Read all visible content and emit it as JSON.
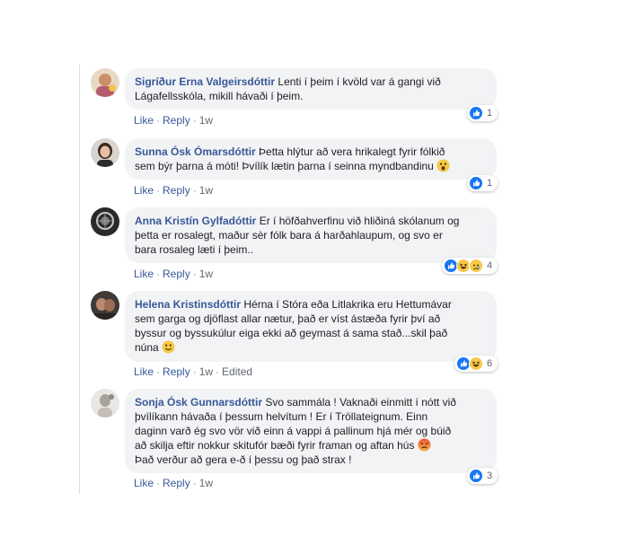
{
  "comments": [
    {
      "author": "Sigríður Erna Valgeirsdóttir",
      "text": "Lenti í þeim í kvöld var á gangi við Lágafellsskóla, mikill hávaði í þeim.",
      "actions": {
        "like": "Like",
        "reply": "Reply",
        "time": "1w"
      },
      "reactions": {
        "icons": [
          "like-icon"
        ],
        "count": "1"
      }
    },
    {
      "author": "Sunna Ósk Ómarsdóttir",
      "text_line1": "Þetta hlýtur að vera hrikalegt fyrir fólkið",
      "text_line2": "sem býr þarna á móti! Þvílík lætin þarna í seinna myndbandinu",
      "emoji": "wow-emoji-icon",
      "actions": {
        "like": "Like",
        "reply": "Reply",
        "time": "1w"
      },
      "reactions": {
        "icons": [
          "like-icon"
        ],
        "count": "1"
      }
    },
    {
      "author": "Anna Kristín Gylfadóttir",
      "text_line1": "Er í höfðahverfinu við hliðiná skólanum og",
      "text_line2": "þetta er rosalegt, maður sèr fólk bara á harðahlaupum, og svo er",
      "text_line3": "bara rosaleg læti í þeim..",
      "actions": {
        "like": "Like",
        "reply": "Reply",
        "time": "1w"
      },
      "reactions": {
        "icons": [
          "like-icon",
          "haha-icon",
          "sad-icon"
        ],
        "count": "4"
      }
    },
    {
      "author": "Helena Kristinsdóttir",
      "text_line1": "Hérna í Stóra eða Litlakrika eru Hettumávar",
      "text_line2": "sem garga og djöflast allar nætur, það er víst ástæða fyrir því að",
      "text_line3": "byssur og byssukúlur eiga ekki að geymast á sama stað...skil það",
      "text_line4": "núna",
      "emoji": "smile-emoji-icon",
      "actions": {
        "like": "Like",
        "reply": "Reply",
        "time": "1w",
        "edited": "Edited"
      },
      "reactions": {
        "icons": [
          "like-icon",
          "haha-icon"
        ],
        "count": "6"
      }
    },
    {
      "author": "Sonja Ósk Gunnarsdóttir",
      "text_line1": "Svo sammála ! Vaknaði einmitt í nótt við",
      "text_line2": "þvílíkann hávaða í þessum helvítum ! Er í Tröllateignum. Einn",
      "text_line3": "daginn varð ég svo vör við einn á vappi á pallinum hjá mér og búið",
      "text_line4": "að skilja eftir nokkur skitufór bæði fyrir framan og aftan hús",
      "text_line5": "Það verður að gera e-ð í þessu og það strax !",
      "emoji": "angry-emoji-icon",
      "actions": {
        "like": "Like",
        "reply": "Reply",
        "time": "1w"
      },
      "reactions": {
        "icons": [
          "like-icon"
        ],
        "count": "3"
      }
    }
  ],
  "separator": "·",
  "colors": {
    "author": "#385898",
    "bubble": "#f2f3f5",
    "like_blue": "#1877f2",
    "meta": "#616770"
  }
}
